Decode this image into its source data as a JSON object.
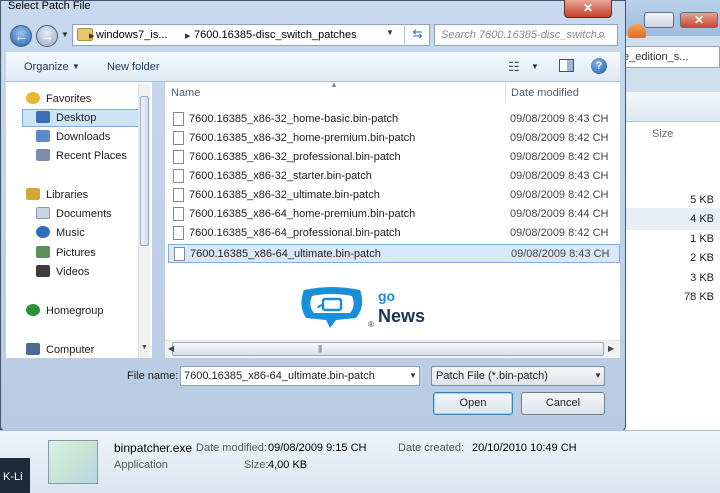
{
  "dialog": {
    "title": "Select Patch File",
    "close_glyph": "✕"
  },
  "address": {
    "crumbs": [
      "windows7_is...",
      "7600.16385-disc_switch_patches"
    ],
    "separator": "▸",
    "search_placeholder": "Search 7600.16385-disc_switch..."
  },
  "toolbar": {
    "organize_label": "Organize",
    "new_folder_label": "New folder",
    "help_glyph": "?"
  },
  "navigation": {
    "items": [
      {
        "label": "Favorites",
        "icon": "star-icon",
        "color": "#e8b92e"
      },
      {
        "label": "Desktop",
        "icon": "desktop-icon",
        "color": "#3a6fb3"
      },
      {
        "label": "Downloads",
        "icon": "downloads-folder-icon",
        "color": "#5a8dc8"
      },
      {
        "label": "Recent Places",
        "icon": "recent-places-icon",
        "color": "#7b8ea8"
      },
      {
        "label": "Libraries",
        "icon": "libraries-icon",
        "color": "#d5a63a"
      },
      {
        "label": "Documents",
        "icon": "documents-icon",
        "color": "#c9d5e4"
      },
      {
        "label": "Music",
        "icon": "music-icon",
        "color": "#2f6fbf"
      },
      {
        "label": "Pictures",
        "icon": "pictures-icon",
        "color": "#5b8f5b"
      },
      {
        "label": "Videos",
        "icon": "videos-icon",
        "color": "#3c3c3c"
      },
      {
        "label": "Homegroup",
        "icon": "homegroup-icon",
        "color": "#2c8f3a"
      },
      {
        "label": "Computer",
        "icon": "computer-icon",
        "color": "#4a6a93"
      }
    ]
  },
  "filelist": {
    "col_name": "Name",
    "col_date": "Date modified",
    "files": [
      {
        "name": "7600.16385_x86-32_home-basic.bin-patch",
        "date": "09/08/2009 8:43 CH"
      },
      {
        "name": "7600.16385_x86-32_home-premium.bin-patch",
        "date": "09/08/2009 8:42 CH"
      },
      {
        "name": "7600.16385_x86-32_professional.bin-patch",
        "date": "09/08/2009 8:42 CH"
      },
      {
        "name": "7600.16385_x86-32_starter.bin-patch",
        "date": "09/08/2009 8:43 CH"
      },
      {
        "name": "7600.16385_x86-32_ultimate.bin-patch",
        "date": "09/08/2009 8:42 CH"
      },
      {
        "name": "7600.16385_x86-64_home-premium.bin-patch",
        "date": "09/08/2009 8:44 CH"
      },
      {
        "name": "7600.16385_x86-64_professional.bin-patch",
        "date": "09/08/2009 8:42 CH"
      },
      {
        "name": "7600.16385_x86-64_ultimate.bin-patch",
        "date": "09/08/2009 8:43 CH"
      }
    ],
    "selected_index": 7
  },
  "bottom": {
    "filename_label": "File name:",
    "filename_value": "7600.16385_x86-64_ultimate.bin-patch",
    "filetype_value": "Patch File (*.bin-patch)",
    "open_label": "Open",
    "cancel_label": "Cancel"
  },
  "watermark": {
    "go": "go",
    "news": "News",
    "reg": "®"
  },
  "background_window": {
    "address_fragment": "e_edition_s...",
    "size_header": "Size",
    "sizes": [
      "5 KB",
      "4 KB",
      "1 KB",
      "2 KB",
      "3 KB",
      "78 KB"
    ],
    "partial_text": "ve"
  },
  "details": {
    "name": "binpatcher.exe",
    "type": "Application",
    "modified_label": "Date modified:",
    "modified_value": "09/08/2009 9:15 CH",
    "created_label": "Date created:",
    "created_value": "20/10/2010 10:49 CH",
    "size_label": "Size:",
    "size_value": "4,00 KB"
  },
  "taskbar": {
    "text": "K-Li"
  }
}
